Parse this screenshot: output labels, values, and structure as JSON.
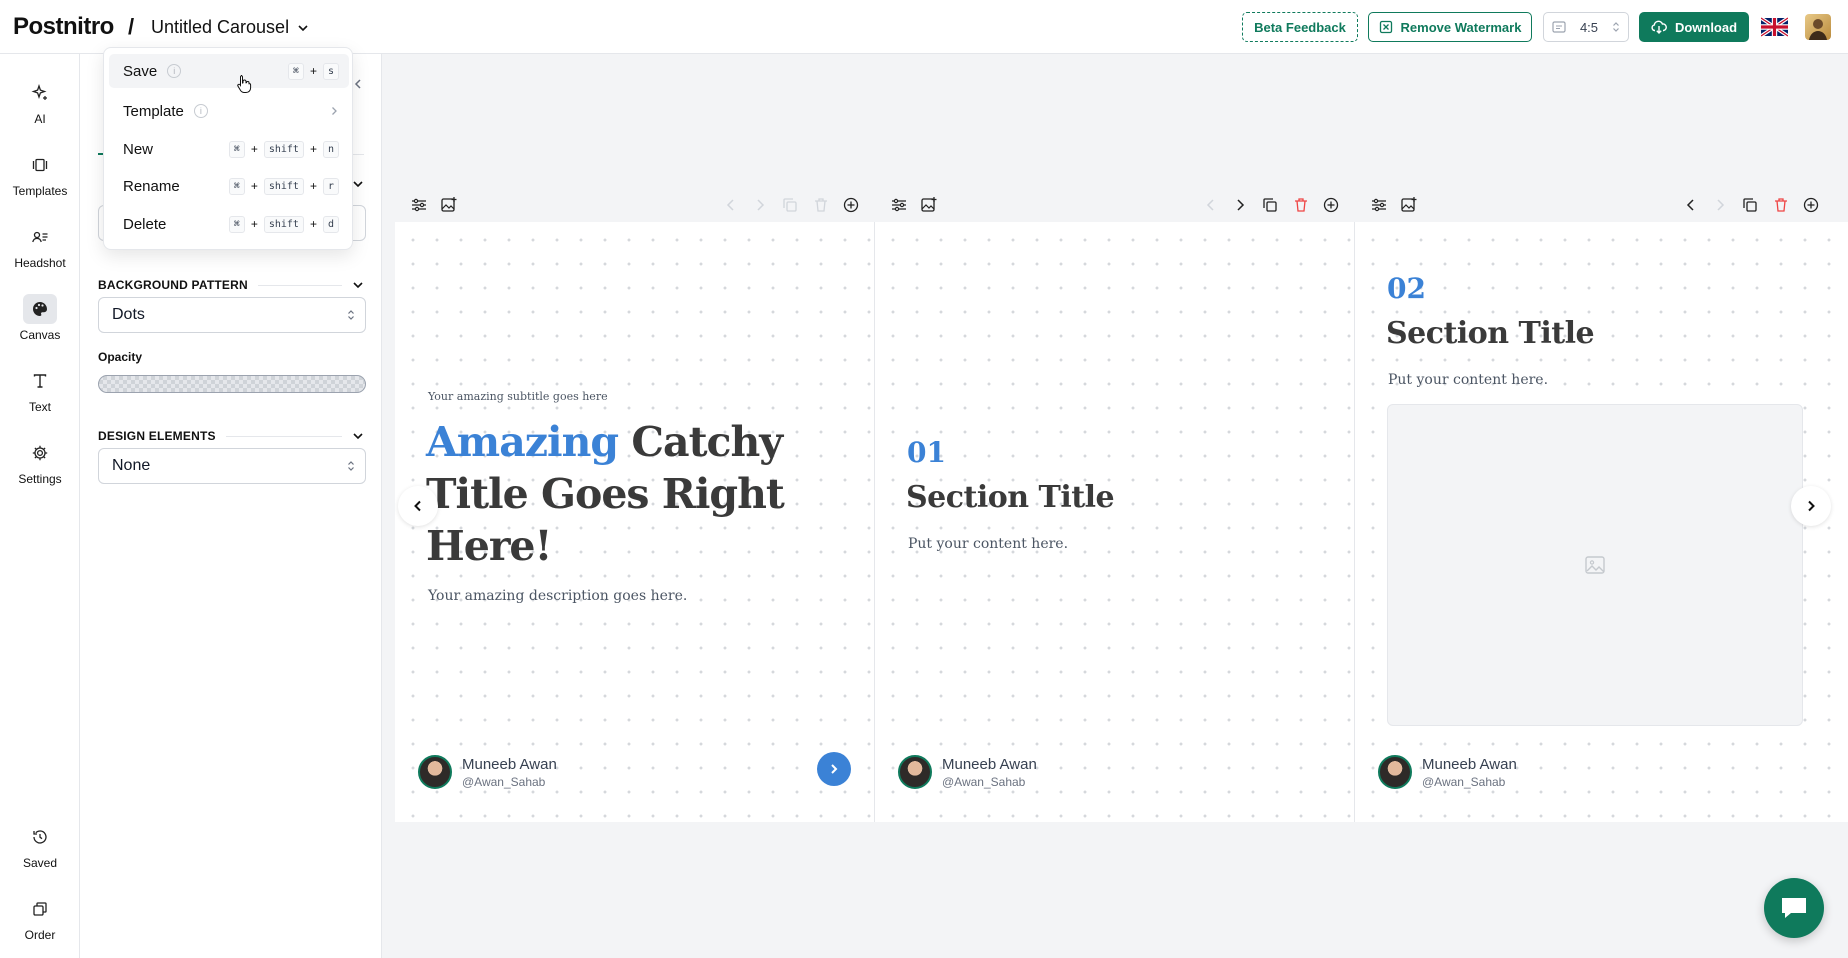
{
  "header": {
    "logo": "Postnitro",
    "separator": "/",
    "doc_title": "Untitled Carousel",
    "beta_feedback": "Beta Feedback",
    "remove_watermark": "Remove Watermark",
    "ratio": "4:5",
    "download": "Download"
  },
  "rail": {
    "items": [
      {
        "label": "AI",
        "icon": "sparkle-icon"
      },
      {
        "label": "Templates",
        "icon": "templates-icon"
      },
      {
        "label": "Headshot",
        "icon": "headshot-icon"
      },
      {
        "label": "Canvas",
        "icon": "palette-icon"
      },
      {
        "label": "Text",
        "icon": "text-icon"
      },
      {
        "label": "Settings",
        "icon": "gear-icon"
      },
      {
        "label": "Saved",
        "icon": "history-icon"
      },
      {
        "label": "Order",
        "icon": "order-icon"
      }
    ],
    "active": "Canvas"
  },
  "panel": {
    "background_pattern_label": "BACKGROUND PATTERN",
    "background_pattern_value": "Dots",
    "opacity_label": "Opacity",
    "design_elements_label": "DESIGN ELEMENTS",
    "design_elements_value": "None"
  },
  "menu": {
    "items": [
      {
        "label": "Save",
        "info": "i",
        "keys": [
          "⌘",
          "s"
        ]
      },
      {
        "label": "Template",
        "info": "i",
        "submenu": true
      },
      {
        "label": "New",
        "keys": [
          "⌘",
          "shift",
          "n"
        ]
      },
      {
        "label": "Rename",
        "keys": [
          "⌘",
          "shift",
          "r"
        ]
      },
      {
        "label": "Delete",
        "keys": [
          "⌘",
          "shift",
          "d"
        ]
      }
    ],
    "plus": "+"
  },
  "slides": {
    "slide1": {
      "subtitle": "Your amazing subtitle goes here",
      "title_accent": "Amazing",
      "title_rest": " Catchy Title Goes Right Here!",
      "description": "Your amazing description goes here."
    },
    "slide2": {
      "number": "01",
      "title": "Section Title",
      "body": "Put your content here."
    },
    "slide3": {
      "number": "02",
      "title": "Section Title",
      "body": "Put your content here."
    },
    "author": {
      "name": "Muneeb Awan",
      "handle": "@Awan_Sahab"
    }
  },
  "colors": {
    "brand": "#0f7a5c",
    "accent": "#3b82d6",
    "danger": "#ef4444"
  }
}
